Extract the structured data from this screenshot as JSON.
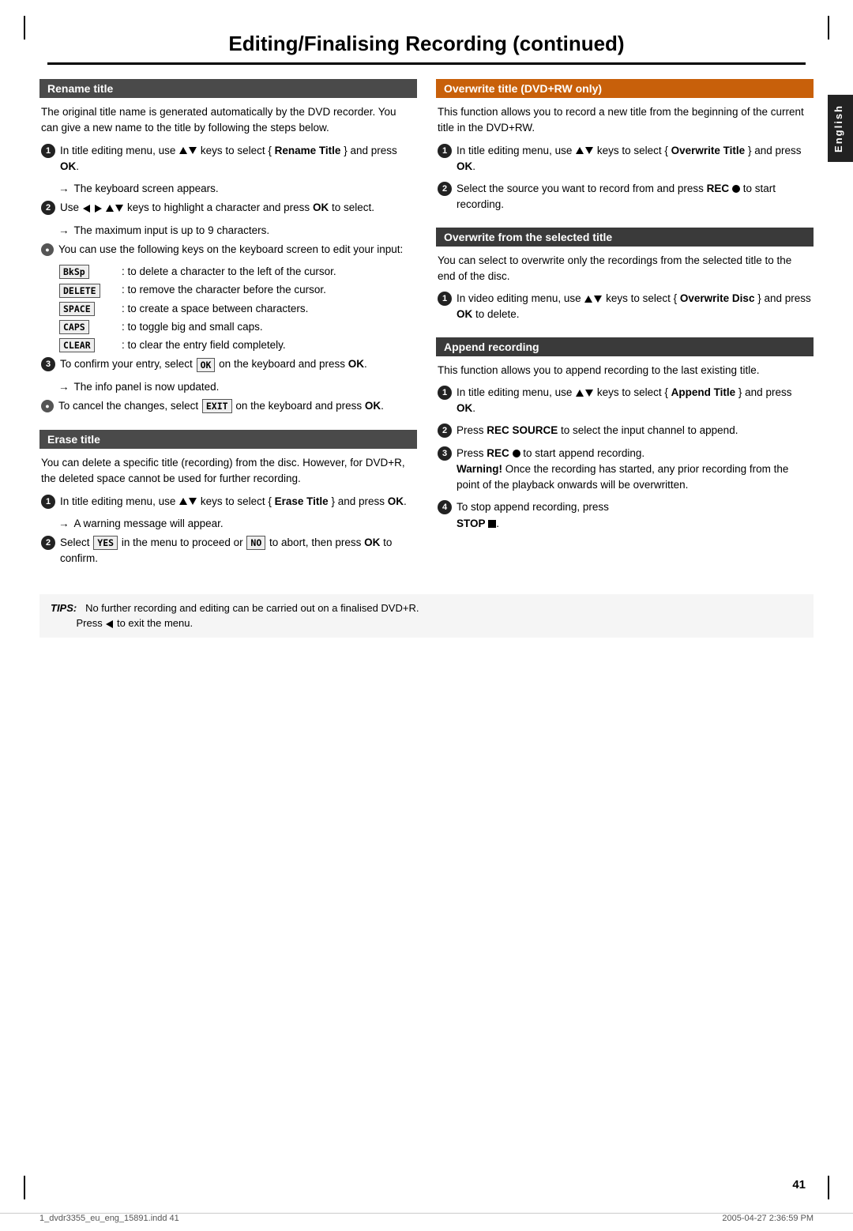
{
  "page": {
    "title": "Editing/Finalising Recording",
    "title_suffix": " (continued)",
    "page_number": "41",
    "language_tab": "English",
    "footer_left": "1_dvdr3355_eu_eng_15891.indd  41",
    "footer_right": "2005-04-27  2:36:59 PM"
  },
  "tips": {
    "label": "TIPS:",
    "text": "No further recording and editing can be carried out on a finalised DVD+R.\nPress ◄ to exit the menu."
  },
  "left": {
    "rename_title": {
      "header": "Rename title",
      "intro": "The original title name is generated automatically by the DVD recorder. You can give a new name to the title by following the steps below.",
      "step1_text": "In title editing menu, use ▲▼ keys to select { Rename Title } and press OK.",
      "step1_arrow": "The keyboard screen appears.",
      "step2_text": "Use ◄ ► ▲▼ keys to highlight a character and press OK to select.",
      "step2_arrow": "The maximum input is up to 9 characters.",
      "bullet1_intro": "You can use the following keys on the keyboard screen to edit your input:",
      "keys": [
        {
          "badge": "BkSp",
          "desc": ": to delete a character to the left of the cursor."
        },
        {
          "badge": "DELETE",
          "desc": ": to remove the character before the cursor."
        },
        {
          "badge": "SPACE",
          "desc": ": to create a space between characters."
        },
        {
          "badge": "CAPS",
          "desc": ": to toggle big and small caps."
        },
        {
          "badge": "CLEAR",
          "desc": ": to clear the entry field completely."
        }
      ],
      "step3_text": "To confirm your entry, select OK on the keyboard and press OK.",
      "step3_arrow": "The info panel is now updated.",
      "bullet2_text": "To cancel the changes, select EXIT on the keyboard and press OK."
    },
    "erase_title": {
      "header": "Erase title",
      "intro": "You can delete a specific title (recording) from the disc. However, for DVD+R, the deleted space cannot be used for further recording.",
      "step1_text": "In title editing menu, use ▲▼ keys to select { Erase Title } and press OK.",
      "step1_arrow": "A warning message will appear.",
      "step2_text": "Select YES in the menu to proceed or NO to abort, then press OK to confirm."
    }
  },
  "right": {
    "overwrite_dvdrw": {
      "header": "Overwrite title (DVD+RW only)",
      "intro": "This function allows you to record a new title from the beginning of the current title in the DVD+RW.",
      "step1_text": "In title editing menu, use ▲▼ keys to select { Overwrite Title } and press OK.",
      "step2_text": "Select the source you want to record from and press REC ● to start recording."
    },
    "overwrite_selected": {
      "header": "Overwrite from the selected title",
      "intro": "You can select to overwrite only the recordings from the selected title to the end of the disc.",
      "step1_text": "In video editing menu, use ▲▼ keys to select { Overwrite Disc } and press OK to delete."
    },
    "append_recording": {
      "header": "Append recording",
      "intro": "This function allows you to append recording to the last existing title.",
      "step1_text": "In title editing menu, use ▲▼ keys to select { Append Title } and press OK.",
      "step2_text": "Press REC SOURCE to select the input channel to append.",
      "step3_text": "Press REC ● to start append recording. Warning! Once the recording has started, any prior recording from the point of the playback onwards will be overwritten.",
      "step4_text": "To stop append recording, press STOP ■."
    }
  }
}
